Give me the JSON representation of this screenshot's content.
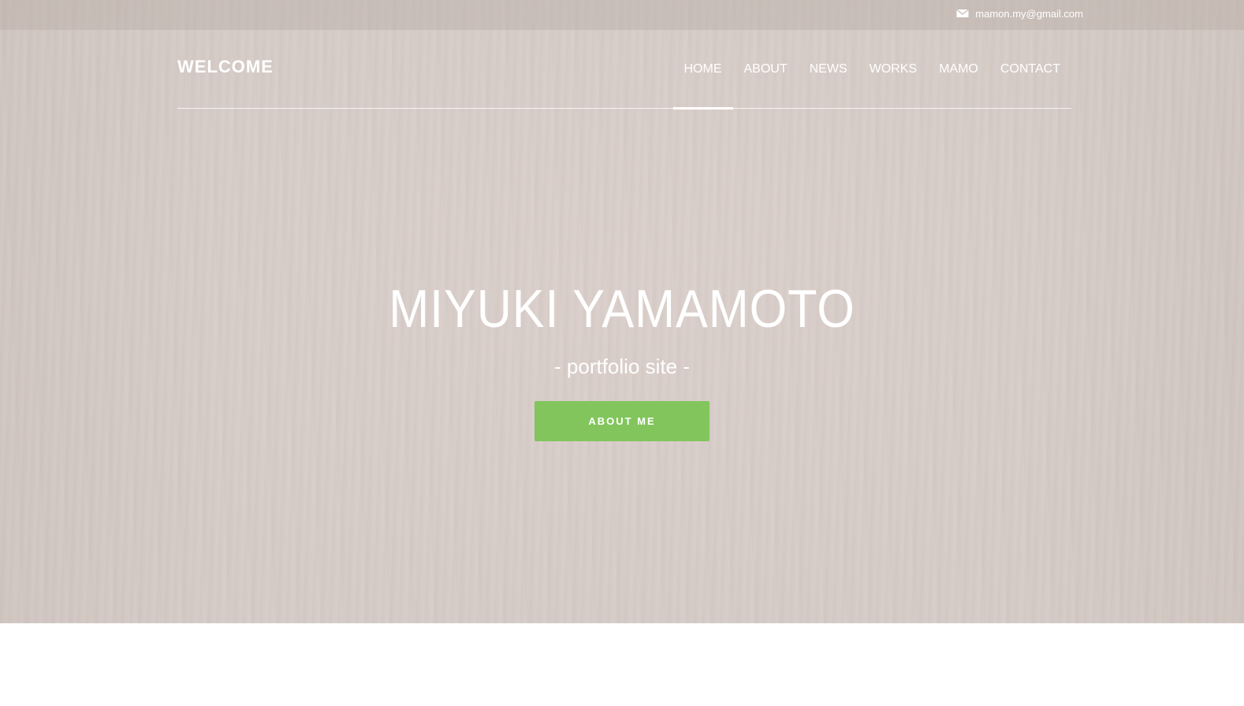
{
  "topbar": {
    "email": "mamon.my@gmail.com",
    "icon": "mail-icon"
  },
  "header": {
    "brand": "WELCOME",
    "nav": [
      {
        "label": "HOME",
        "active": true
      },
      {
        "label": "ABOUT",
        "active": false
      },
      {
        "label": "NEWS",
        "active": false
      },
      {
        "label": "WORKS",
        "active": false
      },
      {
        "label": "MAMO",
        "active": false
      },
      {
        "label": "CONTACT",
        "active": false
      }
    ]
  },
  "hero": {
    "title": "MIYUKI YAMAMOTO",
    "subtitle": "- portfolio site -",
    "button_label": "ABOUT ME"
  },
  "colors": {
    "hero_background": "#d6ccc7",
    "accent_button": "#82c55c",
    "text": "#ffffff"
  }
}
